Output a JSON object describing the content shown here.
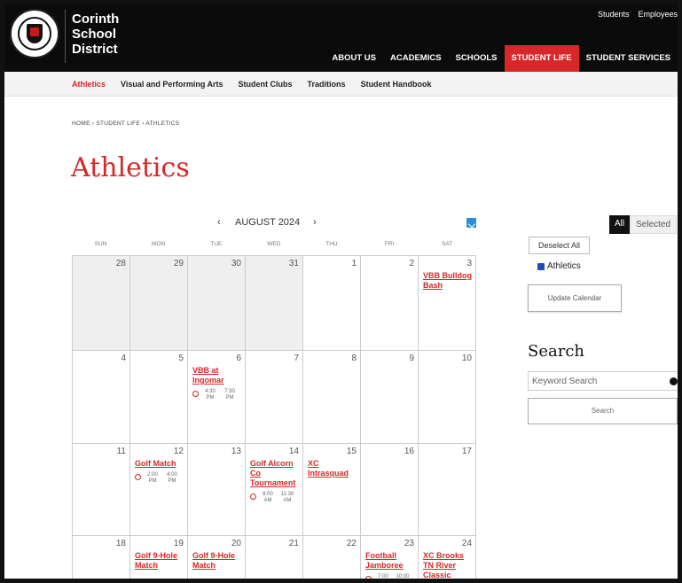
{
  "header": {
    "seal_text": "CORINTH",
    "district_name": [
      "Corinth",
      "School",
      "District"
    ],
    "utility_links": [
      "Students",
      "Employees"
    ],
    "nav": [
      "ABOUT US",
      "ACADEMICS",
      "SCHOOLS",
      "STUDENT LIFE",
      "STUDENT SERVICES"
    ],
    "active_nav": "STUDENT LIFE",
    "accent_color": "#d62828"
  },
  "subnav": {
    "items": [
      "Athletics",
      "Visual and Performing Arts",
      "Student Clubs",
      "Traditions",
      "Student Handbook"
    ],
    "active": "Athletics"
  },
  "breadcrumb": "HOME › STUDENT LIFE › ATHLETICS",
  "page_title": "Athletics",
  "calendar": {
    "month_label": "AUGUST 2024",
    "prev": "‹",
    "next": "›",
    "days_of_week": [
      "SUN",
      "MON",
      "TUE",
      "WED",
      "THU",
      "FRI",
      "SAT"
    ],
    "weeks": [
      [
        {
          "day": "28",
          "other": true
        },
        {
          "day": "29",
          "other": true
        },
        {
          "day": "30",
          "other": true
        },
        {
          "day": "31",
          "other": true
        },
        {
          "day": "1"
        },
        {
          "day": "2"
        },
        {
          "day": "3",
          "event": {
            "title": "VBB Bulldog Bash"
          }
        }
      ],
      [
        {
          "day": "4"
        },
        {
          "day": "5"
        },
        {
          "day": "6",
          "event": {
            "title": "VBB at Ingomar",
            "start": "4:30 PM",
            "end": "7:30 PM"
          }
        },
        {
          "day": "7"
        },
        {
          "day": "8"
        },
        {
          "day": "9"
        },
        {
          "day": "10"
        }
      ],
      [
        {
          "day": "11"
        },
        {
          "day": "12",
          "event": {
            "title": "Golf Match",
            "start": "2:00 PM",
            "end": "4:00 PM"
          }
        },
        {
          "day": "13"
        },
        {
          "day": "14",
          "event": {
            "title": "Golf Alcorn Co Tournament",
            "start": "8:00 AM",
            "end": "11:30 AM"
          }
        },
        {
          "day": "15",
          "event": {
            "title": "XC Intrasquad"
          }
        },
        {
          "day": "16"
        },
        {
          "day": "17"
        }
      ],
      [
        {
          "day": "18"
        },
        {
          "day": "19",
          "event": {
            "title": "Golf 9-Hole Match"
          }
        },
        {
          "day": "20",
          "event": {
            "title": "Golf 9-Hole Match"
          }
        },
        {
          "day": "21"
        },
        {
          "day": "22"
        },
        {
          "day": "23",
          "event": {
            "title": "Football Jamboree",
            "start": "7:00",
            "end": "10:00"
          }
        },
        {
          "day": "24",
          "event": {
            "title": "XC Brooks TN River Classic"
          }
        }
      ]
    ]
  },
  "filters": {
    "tab_all": "All",
    "tab_selected": "Selected",
    "deselect_all": "Deselect All",
    "category": "Athletics",
    "update_button": "Update Calendar"
  },
  "search": {
    "title": "Search",
    "placeholder": "Keyword Search",
    "button": "Search"
  }
}
